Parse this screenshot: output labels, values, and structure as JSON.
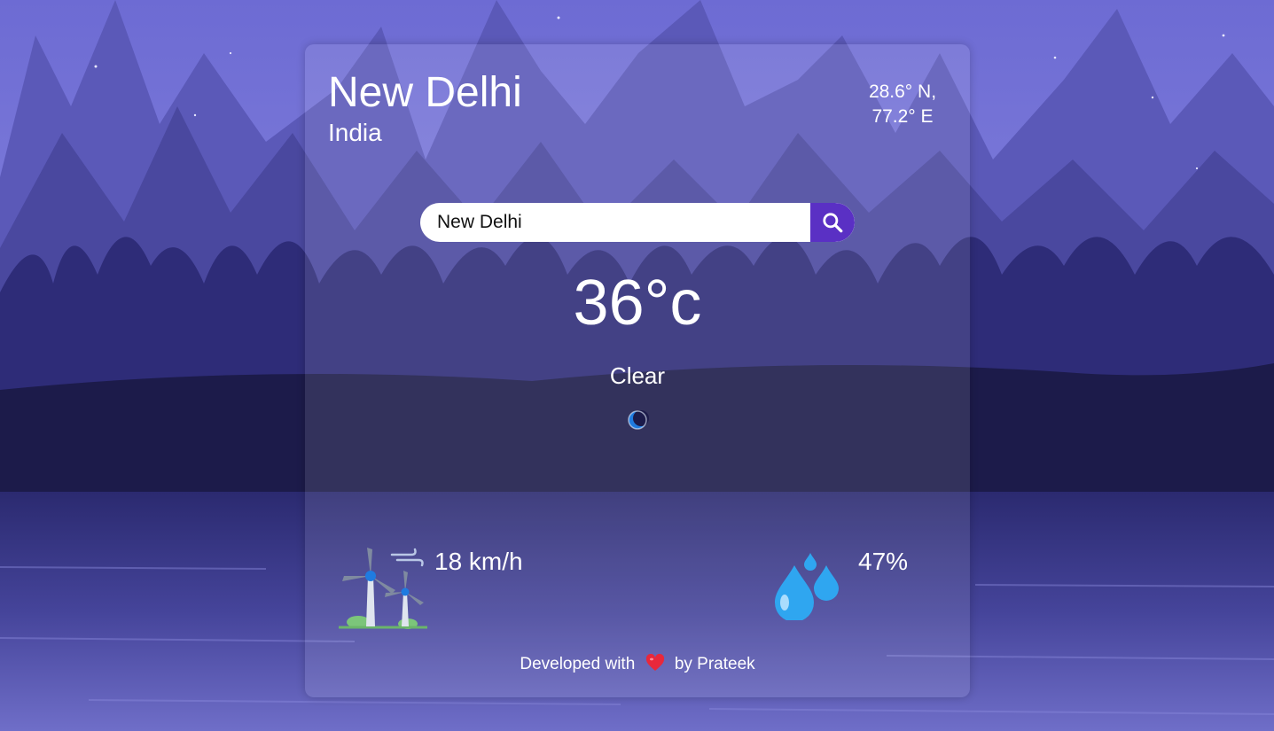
{
  "location": {
    "city": "New Delhi",
    "country": "India",
    "lat": "28.6° N,",
    "lon": "77.2° E"
  },
  "search": {
    "value": "New Delhi",
    "button_icon": "search-icon"
  },
  "weather": {
    "temperature": "36°c",
    "condition": "Clear",
    "condition_icon": "crescent-moon-icon"
  },
  "stats": {
    "wind": {
      "icon": "wind-turbine-icon",
      "value": "18 km/h"
    },
    "humidity": {
      "icon": "water-drops-icon",
      "value": "47%"
    }
  },
  "footer": {
    "prefix": "Developed with",
    "icon": "heart-icon",
    "suffix": "by Prateek"
  },
  "colors": {
    "accent": "#5a30c4",
    "sky": "#6a6ad0",
    "water": "#3c3b8c"
  }
}
